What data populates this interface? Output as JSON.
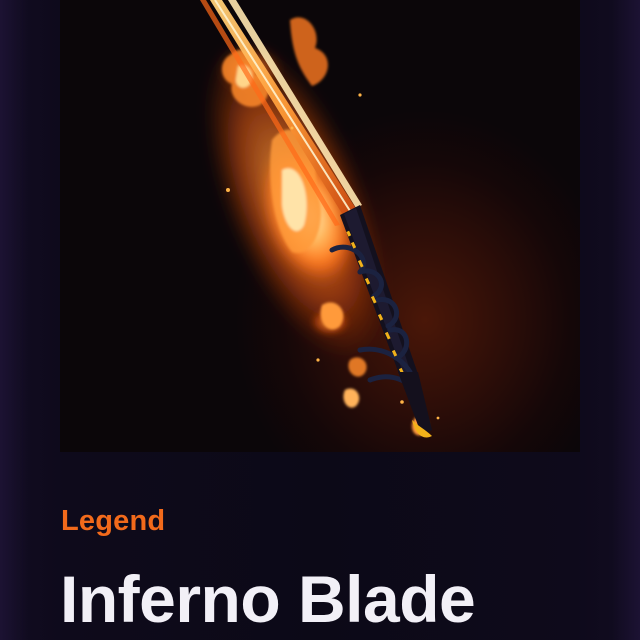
{
  "item": {
    "rarity": "Legend",
    "name": "Inferno Blade",
    "image": "inferno-blade-flaming-sword"
  },
  "colors": {
    "rarity_accent": "#f26a1b",
    "title_text": "#f2f0f7",
    "background": "#0c0917"
  }
}
